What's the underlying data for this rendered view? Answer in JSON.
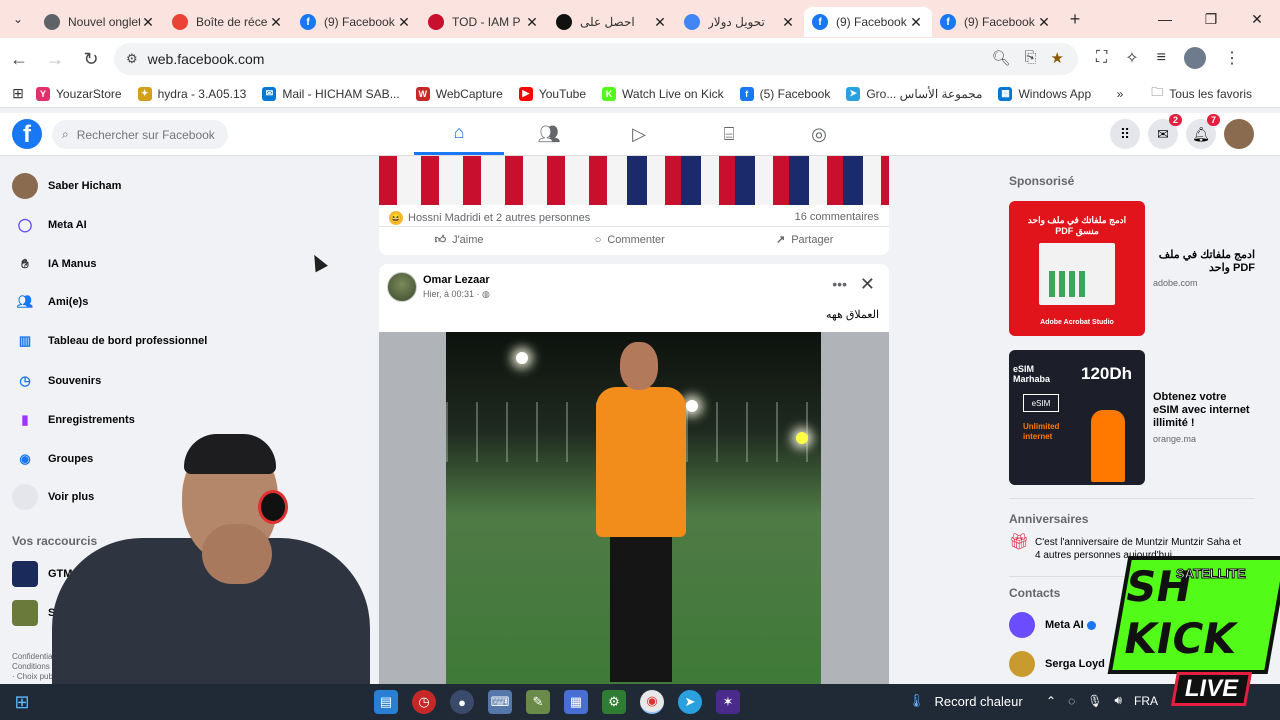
{
  "browser": {
    "tabs": [
      {
        "title": "Nouvel onglet",
        "icon": "chrome-icon",
        "color": "#5f6368"
      },
      {
        "title": "Boîte de réception",
        "icon": "gmail-icon",
        "color": "#ea4335"
      },
      {
        "title": "(9) Facebook",
        "icon": "facebook-icon",
        "color": "#1877f2"
      },
      {
        "title": "TOD - IAM P",
        "icon": "tod-icon",
        "color": "#c8102e"
      },
      {
        "title": "احصل على",
        "icon": "tod-black-icon",
        "color": "#111111"
      },
      {
        "title": "تحويل دولار",
        "icon": "google-icon",
        "color": "#4285f4"
      },
      {
        "title": "(9) Facebook",
        "icon": "facebook-icon",
        "color": "#1877f2",
        "active": true
      },
      {
        "title": "(9) Facebook",
        "icon": "facebook-icon",
        "color": "#1877f2"
      }
    ],
    "url": "web.facebook.com",
    "bookmarks": [
      {
        "label": "YouzarStore",
        "color": "#e1306c",
        "glyph": "Y"
      },
      {
        "label": "hydra - 3.A05.13",
        "color": "#d4a017",
        "glyph": "✦"
      },
      {
        "label": "Mail - HICHAM SAB...",
        "color": "#0078d4",
        "glyph": "✉"
      },
      {
        "label": "WebCapture",
        "color": "#c62828",
        "glyph": "W"
      },
      {
        "label": "YouTube",
        "color": "#ff0000",
        "glyph": "▶"
      },
      {
        "label": "Watch Live on Kick",
        "color": "#53fc18",
        "glyph": "K"
      },
      {
        "label": "(5) Facebook",
        "color": "#1877f2",
        "glyph": "f"
      },
      {
        "label": "Gro... مجموعة الأساس",
        "color": "#2aa1de",
        "glyph": "➤"
      },
      {
        "label": "Windows App",
        "color": "#0078d4",
        "glyph": "▦"
      }
    ],
    "all_bookmarks": "Tous les favoris"
  },
  "facebook": {
    "search_placeholder": "Rechercher sur Facebook",
    "badges": {
      "messenger": "2",
      "notifications": "7"
    },
    "sidebar": [
      {
        "label": "Saber Hicham",
        "icon": "profile-avatar",
        "color": "#8a6b4f"
      },
      {
        "label": "Meta AI",
        "icon": "meta-ai-icon",
        "color": "#6b4cff"
      },
      {
        "label": "IA Manus",
        "icon": "manus-icon",
        "color": "#333333"
      },
      {
        "label": "Ami(e)s",
        "icon": "friends-icon",
        "color": "#1877f2"
      },
      {
        "label": "Tableau de bord professionnel",
        "icon": "dashboard-icon",
        "color": "#1877f2"
      },
      {
        "label": "Souvenirs",
        "icon": "clock-icon",
        "color": "#1877f2"
      },
      {
        "label": "Enregistrements",
        "icon": "bookmark-icon",
        "color": "#a033ff"
      },
      {
        "label": "Groupes",
        "icon": "groups-icon",
        "color": "#1877f2"
      },
      {
        "label": "Voir plus",
        "icon": "chevron-down-icon",
        "color": "#e4e6eb"
      }
    ],
    "shortcuts_title": "Vos raccourcis",
    "shortcuts": [
      {
        "label": "GTMedia Arab & Eu...",
        "color": "#1a2a5a"
      },
      {
        "label": "SH live",
        "color": "#6a7a3a"
      }
    ],
    "footer": "Confidentialité · Conditions · Publicités · Choix publicitaires",
    "post_a": {
      "reactions": "Hossni Madridi et 2 autres personnes",
      "comments": "16 commentaires",
      "like": "J'aime",
      "comment": "Commenter",
      "share": "Partager"
    },
    "post_b": {
      "author": "Omar Lezaar",
      "time": "Hier, à 00:31 · ",
      "caption": "العملاق ههه"
    },
    "right": {
      "sponsored": "Sponsorisé",
      "ads": [
        {
          "title": "ادمج ملفاتك في ملف PDF واحد",
          "domain": "adobe.com",
          "image_text": "ادمج ملفاتك في ملف واحد منسق PDF",
          "brand": "Adobe Acrobat Studio"
        },
        {
          "title": "Obtenez votre eSIM avec internet illimité !",
          "domain": "orange.ma",
          "image_text": "eSIM Marhaba",
          "price": "120Dh",
          "esim": "eSIM",
          "offer": "Unlimited internet"
        }
      ],
      "birthdays_title": "Anniversaires",
      "birthday_text": "C'est l'anniversaire de Muntzir Muntzir Saha et 4 autres personnes aujourd'hui.",
      "contacts_title": "Contacts",
      "contacts": [
        {
          "name": "Meta AI",
          "color": "#6b4cff",
          "verified": true
        },
        {
          "name": "Serga Loyd",
          "color": "#c99a2e",
          "verified": false
        }
      ]
    }
  },
  "overlay": {
    "logo_top": "SH",
    "logo_sub": "SATELLITE",
    "logo_main": "KICK",
    "logo_live": "LIVE"
  },
  "taskbar": {
    "weather": "Record chaleur",
    "language": "FRA"
  }
}
